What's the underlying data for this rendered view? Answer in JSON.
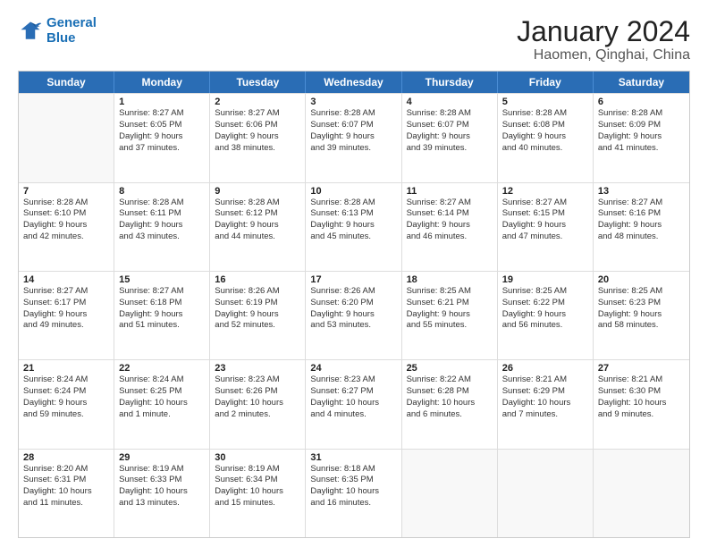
{
  "logo": {
    "line1": "General",
    "line2": "Blue"
  },
  "title": "January 2024",
  "subtitle": "Haomen, Qinghai, China",
  "header_days": [
    "Sunday",
    "Monday",
    "Tuesday",
    "Wednesday",
    "Thursday",
    "Friday",
    "Saturday"
  ],
  "weeks": [
    [
      {
        "day": "",
        "lines": []
      },
      {
        "day": "1",
        "lines": [
          "Sunrise: 8:27 AM",
          "Sunset: 6:05 PM",
          "Daylight: 9 hours",
          "and 37 minutes."
        ]
      },
      {
        "day": "2",
        "lines": [
          "Sunrise: 8:27 AM",
          "Sunset: 6:06 PM",
          "Daylight: 9 hours",
          "and 38 minutes."
        ]
      },
      {
        "day": "3",
        "lines": [
          "Sunrise: 8:28 AM",
          "Sunset: 6:07 PM",
          "Daylight: 9 hours",
          "and 39 minutes."
        ]
      },
      {
        "day": "4",
        "lines": [
          "Sunrise: 8:28 AM",
          "Sunset: 6:07 PM",
          "Daylight: 9 hours",
          "and 39 minutes."
        ]
      },
      {
        "day": "5",
        "lines": [
          "Sunrise: 8:28 AM",
          "Sunset: 6:08 PM",
          "Daylight: 9 hours",
          "and 40 minutes."
        ]
      },
      {
        "day": "6",
        "lines": [
          "Sunrise: 8:28 AM",
          "Sunset: 6:09 PM",
          "Daylight: 9 hours",
          "and 41 minutes."
        ]
      }
    ],
    [
      {
        "day": "7",
        "lines": [
          "Sunrise: 8:28 AM",
          "Sunset: 6:10 PM",
          "Daylight: 9 hours",
          "and 42 minutes."
        ]
      },
      {
        "day": "8",
        "lines": [
          "Sunrise: 8:28 AM",
          "Sunset: 6:11 PM",
          "Daylight: 9 hours",
          "and 43 minutes."
        ]
      },
      {
        "day": "9",
        "lines": [
          "Sunrise: 8:28 AM",
          "Sunset: 6:12 PM",
          "Daylight: 9 hours",
          "and 44 minutes."
        ]
      },
      {
        "day": "10",
        "lines": [
          "Sunrise: 8:28 AM",
          "Sunset: 6:13 PM",
          "Daylight: 9 hours",
          "and 45 minutes."
        ]
      },
      {
        "day": "11",
        "lines": [
          "Sunrise: 8:27 AM",
          "Sunset: 6:14 PM",
          "Daylight: 9 hours",
          "and 46 minutes."
        ]
      },
      {
        "day": "12",
        "lines": [
          "Sunrise: 8:27 AM",
          "Sunset: 6:15 PM",
          "Daylight: 9 hours",
          "and 47 minutes."
        ]
      },
      {
        "day": "13",
        "lines": [
          "Sunrise: 8:27 AM",
          "Sunset: 6:16 PM",
          "Daylight: 9 hours",
          "and 48 minutes."
        ]
      }
    ],
    [
      {
        "day": "14",
        "lines": [
          "Sunrise: 8:27 AM",
          "Sunset: 6:17 PM",
          "Daylight: 9 hours",
          "and 49 minutes."
        ]
      },
      {
        "day": "15",
        "lines": [
          "Sunrise: 8:27 AM",
          "Sunset: 6:18 PM",
          "Daylight: 9 hours",
          "and 51 minutes."
        ]
      },
      {
        "day": "16",
        "lines": [
          "Sunrise: 8:26 AM",
          "Sunset: 6:19 PM",
          "Daylight: 9 hours",
          "and 52 minutes."
        ]
      },
      {
        "day": "17",
        "lines": [
          "Sunrise: 8:26 AM",
          "Sunset: 6:20 PM",
          "Daylight: 9 hours",
          "and 53 minutes."
        ]
      },
      {
        "day": "18",
        "lines": [
          "Sunrise: 8:25 AM",
          "Sunset: 6:21 PM",
          "Daylight: 9 hours",
          "and 55 minutes."
        ]
      },
      {
        "day": "19",
        "lines": [
          "Sunrise: 8:25 AM",
          "Sunset: 6:22 PM",
          "Daylight: 9 hours",
          "and 56 minutes."
        ]
      },
      {
        "day": "20",
        "lines": [
          "Sunrise: 8:25 AM",
          "Sunset: 6:23 PM",
          "Daylight: 9 hours",
          "and 58 minutes."
        ]
      }
    ],
    [
      {
        "day": "21",
        "lines": [
          "Sunrise: 8:24 AM",
          "Sunset: 6:24 PM",
          "Daylight: 9 hours",
          "and 59 minutes."
        ]
      },
      {
        "day": "22",
        "lines": [
          "Sunrise: 8:24 AM",
          "Sunset: 6:25 PM",
          "Daylight: 10 hours",
          "and 1 minute."
        ]
      },
      {
        "day": "23",
        "lines": [
          "Sunrise: 8:23 AM",
          "Sunset: 6:26 PM",
          "Daylight: 10 hours",
          "and 2 minutes."
        ]
      },
      {
        "day": "24",
        "lines": [
          "Sunrise: 8:23 AM",
          "Sunset: 6:27 PM",
          "Daylight: 10 hours",
          "and 4 minutes."
        ]
      },
      {
        "day": "25",
        "lines": [
          "Sunrise: 8:22 AM",
          "Sunset: 6:28 PM",
          "Daylight: 10 hours",
          "and 6 minutes."
        ]
      },
      {
        "day": "26",
        "lines": [
          "Sunrise: 8:21 AM",
          "Sunset: 6:29 PM",
          "Daylight: 10 hours",
          "and 7 minutes."
        ]
      },
      {
        "day": "27",
        "lines": [
          "Sunrise: 8:21 AM",
          "Sunset: 6:30 PM",
          "Daylight: 10 hours",
          "and 9 minutes."
        ]
      }
    ],
    [
      {
        "day": "28",
        "lines": [
          "Sunrise: 8:20 AM",
          "Sunset: 6:31 PM",
          "Daylight: 10 hours",
          "and 11 minutes."
        ]
      },
      {
        "day": "29",
        "lines": [
          "Sunrise: 8:19 AM",
          "Sunset: 6:33 PM",
          "Daylight: 10 hours",
          "and 13 minutes."
        ]
      },
      {
        "day": "30",
        "lines": [
          "Sunrise: 8:19 AM",
          "Sunset: 6:34 PM",
          "Daylight: 10 hours",
          "and 15 minutes."
        ]
      },
      {
        "day": "31",
        "lines": [
          "Sunrise: 8:18 AM",
          "Sunset: 6:35 PM",
          "Daylight: 10 hours",
          "and 16 minutes."
        ]
      },
      {
        "day": "",
        "lines": []
      },
      {
        "day": "",
        "lines": []
      },
      {
        "day": "",
        "lines": []
      }
    ]
  ]
}
